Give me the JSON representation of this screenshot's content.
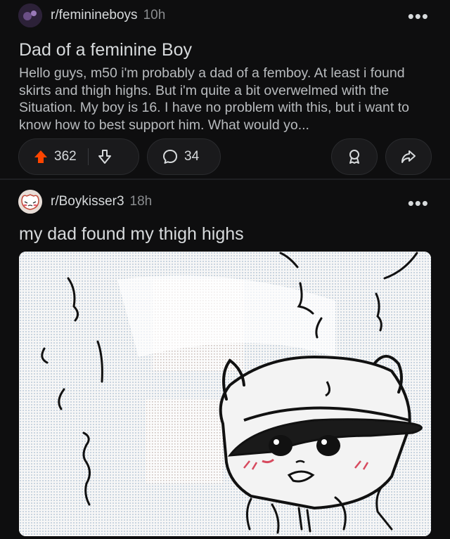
{
  "post1": {
    "subreddit": "r/feminineboys",
    "time": "10h",
    "more": "•••",
    "title": "Dad of a feminine Boy",
    "body": "Hello guys, m50 i'm probably a dad of a femboy. At least i found skirts and thigh highs. But i'm quite a bit overwelmed with the Situation. My boy is 16. I have no problem with this, but i want to know how to best support him. What would yo...",
    "upvotes": "362",
    "comments": "34",
    "upvote_color": "#ff4500"
  },
  "post2": {
    "subreddit": "r/Boykisser3",
    "time": "18h",
    "more": "•••",
    "title": "my dad found my thigh highs",
    "image_icon": "cartoon-boy-image"
  }
}
